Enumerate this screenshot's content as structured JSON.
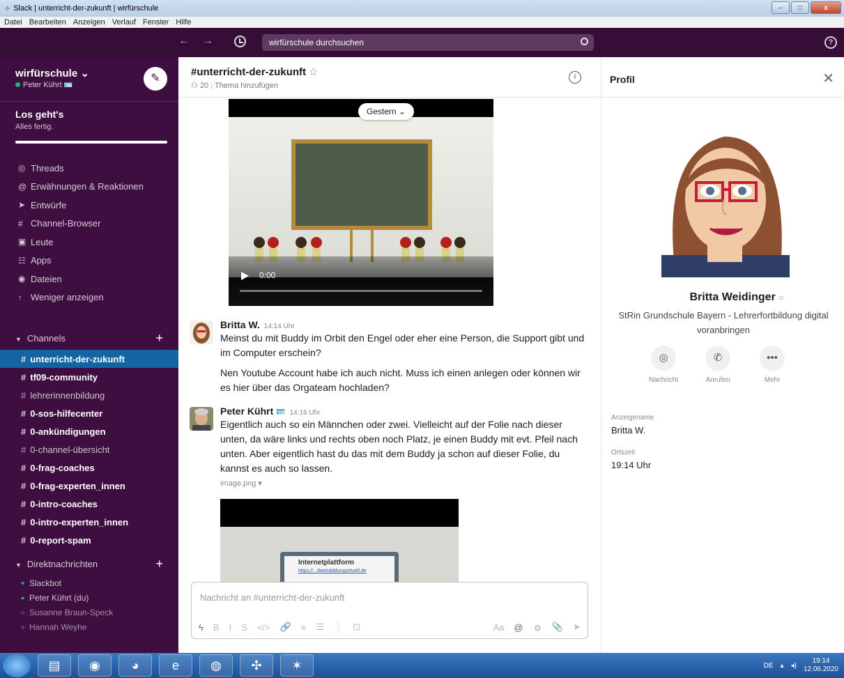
{
  "window": {
    "title": "Slack | unterricht-der-zukunft | wirfürschule",
    "menu": [
      "Datei",
      "Bearbeiten",
      "Anzeigen",
      "Verlauf",
      "Fenster",
      "Hilfe"
    ],
    "controls": [
      "–",
      "□",
      "x"
    ]
  },
  "topbar": {
    "search_placeholder": "wirfürschule durchsuchen",
    "help_icon": "?",
    "back_arrow": "←",
    "forward_arrow": "→"
  },
  "sidebar": {
    "workspace": "wirfürschule ⌄",
    "user": "Peter Kührt",
    "user_emoji": "🪪",
    "getting_started_title": "Los geht's",
    "getting_started_sub": "Alles fertig.",
    "nav": [
      {
        "icon": "◎",
        "label": "Threads"
      },
      {
        "icon": "@",
        "label": "Erwähnungen & Reaktionen"
      },
      {
        "icon": "➤",
        "label": "Entwürfe"
      },
      {
        "icon": "#",
        "label": "Channel-Browser"
      },
      {
        "icon": "▣",
        "label": "Leute"
      },
      {
        "icon": "☷",
        "label": "Apps"
      },
      {
        "icon": "◉",
        "label": "Dateien"
      },
      {
        "icon": "↑",
        "label": "Weniger anzeigen"
      }
    ],
    "channels_header": "Channels",
    "channels": [
      {
        "name": "unterricht-der-zukunft",
        "bold": true,
        "active": true
      },
      {
        "name": "tf09-community",
        "bold": true,
        "active": false
      },
      {
        "name": "lehrerinnenbildung",
        "bold": false,
        "active": false
      },
      {
        "name": "0-sos-hilfecenter",
        "bold": true,
        "active": false
      },
      {
        "name": "0-ankündigungen",
        "bold": true,
        "active": false
      },
      {
        "name": "0-channel-übersicht",
        "bold": false,
        "active": false
      },
      {
        "name": "0-frag-coaches",
        "bold": true,
        "active": false
      },
      {
        "name": "0-frag-experten_innen",
        "bold": true,
        "active": false
      },
      {
        "name": "0-intro-coaches",
        "bold": true,
        "active": false
      },
      {
        "name": "0-intro-experten_innen",
        "bold": true,
        "active": false
      },
      {
        "name": "0-report-spam",
        "bold": true,
        "active": false
      }
    ],
    "dm_header": "Direktnachrichten",
    "dms": [
      {
        "status": "♥",
        "name": "Slackbot"
      },
      {
        "status": "●",
        "name": "Peter Kührt  (du)"
      },
      {
        "status": "○",
        "name": "Susanne Braun-Speck"
      },
      {
        "status": "○",
        "name": "Hannah Weyhe"
      }
    ]
  },
  "channel": {
    "name": "#unterricht-der-zukunft",
    "star": "☆",
    "members": "20",
    "topic": "Thema hinzufügen",
    "date_pill": "Gestern ⌄",
    "video_time": "0:00",
    "messages": [
      {
        "author": "Britta W.",
        "time": "14:14 Uhr",
        "paragraphs": [
          "Meinst du mit Buddy im Orbit den Engel oder eher eine Person, die Support gibt und im Computer erschein?",
          "Nen Youtube Account habe ich auch nicht. Muss ich einen anlegen oder können wir es hier über das Orgateam hochladen?"
        ]
      },
      {
        "author": "Peter Kührt",
        "time": "14:16 Uhr",
        "paragraphs": [
          "Eigentlich auch so ein Männchen oder zwei. Vielleicht auf der Folie nach dieser unten, da wäre links und rechts oben noch Platz, je einen Buddy mit evt. Pfeil nach unten. Aber eigentlich hast du das mit dem Buddy ja schon auf dieser Folie, du kannst es auch so lassen."
        ],
        "attachment": "image.png ▾",
        "attachment_preview_title": "Internetplattform",
        "attachment_preview_link": "https://...dweinbildungvirtuell.de"
      }
    ],
    "composer_placeholder": "Nachricht an #unterricht-der-zukunft",
    "composer_tools": [
      "ϟ",
      "B",
      "I",
      "S",
      "</>",
      "🔗",
      "≡",
      "☰",
      "⋮",
      "⊡"
    ],
    "composer_right": [
      "Aa",
      "@",
      "☺",
      "📎",
      "➤"
    ]
  },
  "profile": {
    "header": "Profil",
    "name": "Britta Weidinger",
    "presence": "○",
    "title": "StRin Grundschule Bayern - Lehrerfortbildung digital voranbringen",
    "actions": [
      {
        "icon": "◎",
        "label": "Nachricht"
      },
      {
        "icon": "✆",
        "label": "Anrufen"
      },
      {
        "icon": "•••",
        "label": "Mehr"
      }
    ],
    "display_name_label": "Anzeigename",
    "display_name": "Britta W.",
    "local_time_label": "Ortszeit",
    "local_time": "19:14 Uhr"
  },
  "taskbar": {
    "lang": "DE",
    "time": "19:14",
    "date": "12.06.2020"
  }
}
